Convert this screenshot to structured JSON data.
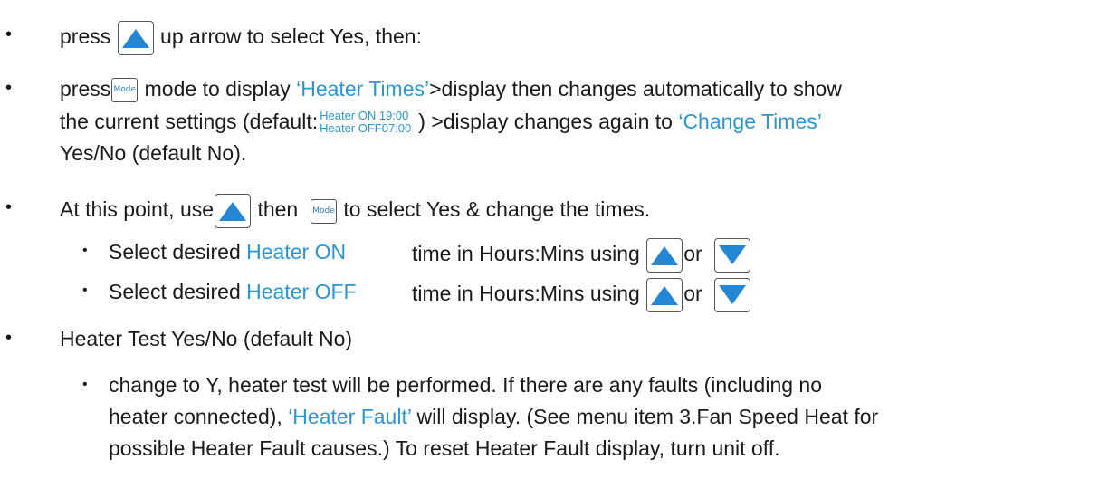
{
  "bullet_char": "•",
  "icons": {
    "up": "up-arrow-key-icon",
    "down": "down-arrow-key-icon",
    "mode": "mode-key-icon"
  },
  "mode_key_label": "Mode",
  "colors": {
    "highlight": "#2a97d4",
    "arrow": "#2387d6",
    "text": "#1a1a1a"
  },
  "l1": {
    "press": "press",
    "rest": "up arrow to select Yes, then:"
  },
  "l2": {
    "press": "press",
    "a": "mode to display ",
    "q1": "‘Heater Times’",
    "b": ">display then changes automatically to show"
  },
  "l3": {
    "a": "the current settings (default:",
    "stack1": "Heater ON 19:00",
    "stack2": "Heater OFF07:00",
    "b": ") >display changes again to ",
    "q2": "‘Change Times’"
  },
  "l4": {
    "text": "Yes/No (default No)."
  },
  "l5": {
    "a": "At this point, use",
    "then": "then",
    "b": "to select Yes & change the times."
  },
  "l6": {
    "a": "Select desired ",
    "hl": "Heater ON",
    "b": "time in Hours:Mins using",
    "or": "or"
  },
  "l7": {
    "a": "Select desired ",
    "hl": "Heater OFF",
    "b": "time in Hours:Mins using",
    "or": "or"
  },
  "l8": {
    "text": "Heater Test Yes/No (default No)"
  },
  "l9": {
    "text": "change to Y, heater test will be performed.  If there are any faults (including no"
  },
  "l10": {
    "a": "heater connected), ",
    "q": "‘Heater Fault’",
    "b": " will display.  (See menu item 3.Fan Speed Heat for"
  },
  "l11": {
    "text": "possible Heater Fault causes.) To reset Heater Fault display, turn unit off."
  }
}
